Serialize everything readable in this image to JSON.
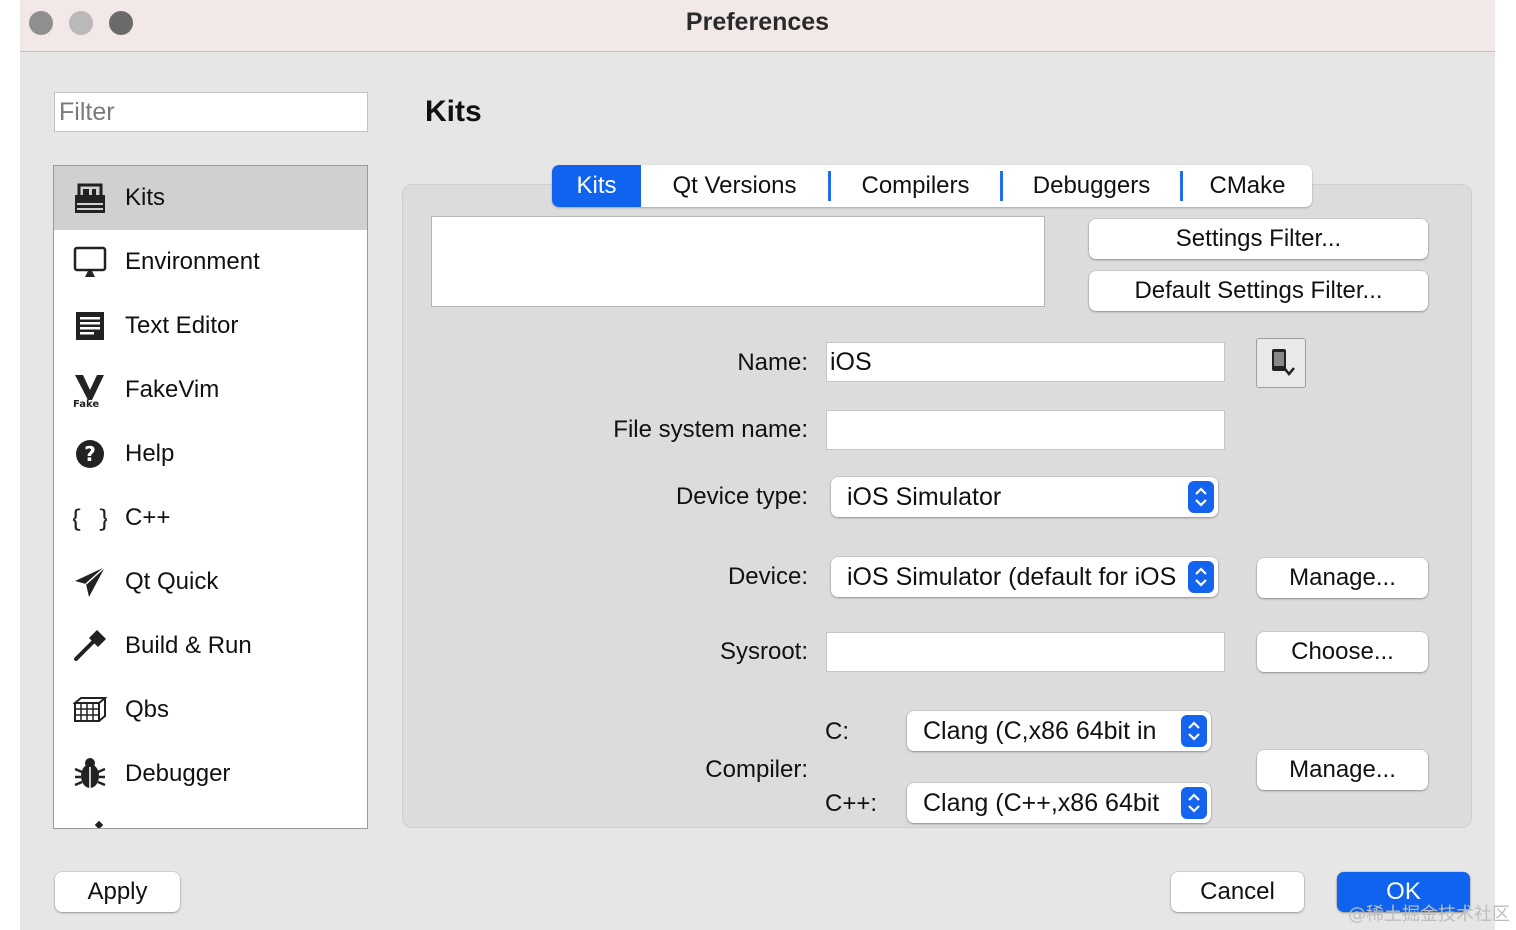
{
  "window": {
    "title": "Preferences"
  },
  "sidebar": {
    "filter_placeholder": "Filter",
    "items": [
      {
        "label": "Kits",
        "icon": "kits-icon",
        "selected": true
      },
      {
        "label": "Environment",
        "icon": "monitor-icon"
      },
      {
        "label": "Text Editor",
        "icon": "text-editor-icon"
      },
      {
        "label": "FakeVim",
        "icon": "fakevim-icon"
      },
      {
        "label": "Help",
        "icon": "help-icon"
      },
      {
        "label": "C++",
        "icon": "braces-icon"
      },
      {
        "label": "Qt Quick",
        "icon": "paper-plane-icon"
      },
      {
        "label": "Build & Run",
        "icon": "hammer-icon"
      },
      {
        "label": "Qbs",
        "icon": "grid-icon"
      },
      {
        "label": "Debugger",
        "icon": "bug-icon"
      }
    ]
  },
  "main": {
    "heading": "Kits",
    "tabs": [
      "Kits",
      "Qt Versions",
      "Compilers",
      "Debuggers",
      "CMake"
    ],
    "active_tab": "Kits",
    "settings_filter_label": "Settings Filter...",
    "default_settings_filter_label": "Default Settings Filter...",
    "form": {
      "name_label": "Name:",
      "name_value": "iOS",
      "fs_name_label": "File system name:",
      "fs_name_value": "",
      "device_type_label": "Device type:",
      "device_type_value": "iOS Simulator",
      "device_label": "Device:",
      "device_value": "iOS Simulator (default for iOS",
      "device_manage_label": "Manage...",
      "sysroot_label": "Sysroot:",
      "sysroot_value": "",
      "sysroot_choose_label": "Choose...",
      "compiler_label": "Compiler:",
      "c_label": "C:",
      "c_value": "Clang (C,x86 64bit in",
      "cpp_label": "C++:",
      "cpp_value": "Clang (C++,x86 64bit",
      "compiler_manage_label": "Manage..."
    }
  },
  "footer": {
    "apply_label": "Apply",
    "cancel_label": "Cancel",
    "ok_label": "OK"
  },
  "watermark": "@稀土掘金技术社区",
  "colors": {
    "accent": "#0f63ef",
    "panel": "#dcdcdc",
    "window": "#e6e6e6",
    "titlebar": "#f2e8e8"
  }
}
